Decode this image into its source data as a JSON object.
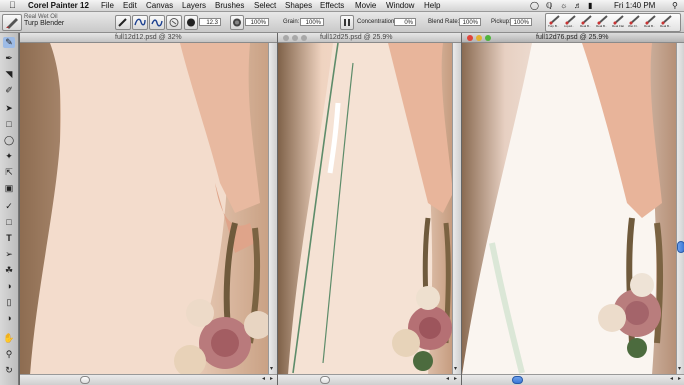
{
  "menubar": {
    "app_name": "Corel Painter 12",
    "menus": [
      "File",
      "Edit",
      "Canvas",
      "Layers",
      "Brushes",
      "Select",
      "Shapes",
      "Effects",
      "Movie",
      "Window",
      "Help"
    ],
    "clock": "Fri 1:40 PM"
  },
  "propbar": {
    "brush_category": "Real Wet Oil",
    "brush_variant": "Turp Blender",
    "size_value": "12.3",
    "opacity_value": "100%",
    "grain_label": "Grain:",
    "grain_value": "100%",
    "concentration_label": "Concentration:",
    "concentration_value": "0%",
    "blend_rate_label": "Blend Rate:",
    "blend_rate_value": "100%",
    "pickup_label": "Pickup:",
    "pickup_value": "100%",
    "brush_tracks": [
      "Turp B..",
      "Liquid..",
      "Real B..",
      "Real B..",
      "Real Flat",
      "Wet Fl..",
      "Real B..",
      "Real B.."
    ]
  },
  "documents": [
    {
      "title": "full12d12.psd @ 32%"
    },
    {
      "title": "full12d25.psd @ 25.9%"
    },
    {
      "title": "full12d76.psd @ 25.9%"
    }
  ],
  "icons": {
    "toolbox": [
      "brush-icon",
      "dropper-icon",
      "eraser-icon",
      "blender-icon",
      "selector-icon",
      "lasso-icon",
      "magic-wand-icon",
      "transform-icon",
      "crop-icon",
      "pen-icon",
      "rectangle-icon",
      "text-icon",
      "shape-select-icon",
      "paint-bucket-icon",
      "cloner-icon",
      "rubber-stamp-icon",
      "dodge-icon",
      "hand-icon",
      "magnifier-icon",
      "rotate-icon"
    ],
    "colors": {
      "accent_blue": "#3a78d8",
      "close_red": "#e0443a",
      "minimize_yellow": "#e3b230",
      "zoom_green": "#4fb43c"
    }
  }
}
